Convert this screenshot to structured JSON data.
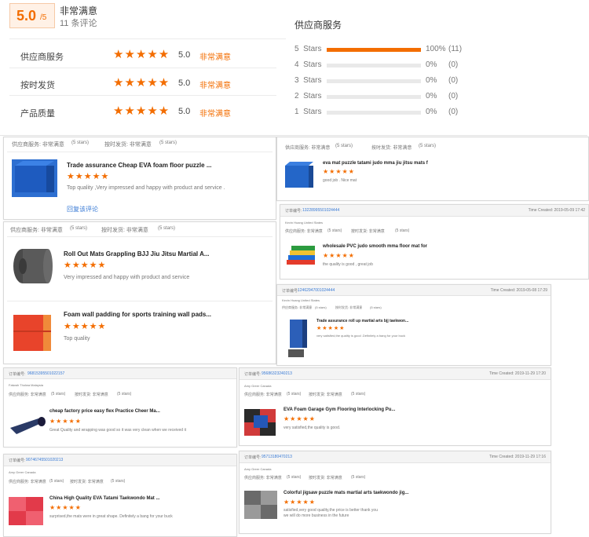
{
  "summary": {
    "score": "5.0",
    "score_max": "/5",
    "label": "非常满意",
    "review_count": "11 条评论",
    "ratings": [
      {
        "label": "供应商服务",
        "stars": "★★★★★",
        "value": "5.0",
        "verdict": "非常满意"
      },
      {
        "label": "按时发货",
        "stars": "★★★★★",
        "value": "5.0",
        "verdict": "非常满意"
      },
      {
        "label": "产品质量",
        "stars": "★★★★★",
        "value": "5.0",
        "verdict": "非常满意"
      }
    ]
  },
  "distribution": {
    "title": "供应商服务",
    "rows": [
      {
        "label": "5  Stars",
        "percent": "100%",
        "count": "(11)",
        "fill": 1.0
      },
      {
        "label": "4  Stars",
        "percent": "0%",
        "count": "(0)",
        "fill": 0
      },
      {
        "label": "3  Stars",
        "percent": "0%",
        "count": "(0)",
        "fill": 0
      },
      {
        "label": "2  Stars",
        "percent": "0%",
        "count": "(0)",
        "fill": 0
      },
      {
        "label": "1  Stars",
        "percent": "0%",
        "count": "(0)",
        "fill": 0
      }
    ]
  },
  "reviews": {
    "r1": {
      "supplier": "供应商服务:  非常满意",
      "supplier_stars": "(5 stars)",
      "ship": "按时发货:  非常满意",
      "ship_stars": "(5 stars)",
      "title": "Trade assurance Cheap EVA foam floor puzzle ...",
      "stars": "★★★★★",
      "comment": "Top quality ,Very impressed and happy with product and service .",
      "reply": "回复该评论"
    },
    "r2": {
      "supplier": "供应商服务:  非常满意",
      "supplier_stars": "(5 stars)",
      "ship": "按时发货:  非常满意",
      "ship_stars": "(5 stars)",
      "title": "eva mat puzzle tatami judo mma jiu jitsu mats f",
      "stars": "★★★★★",
      "comment": "good job . Nice mat"
    },
    "r3": {
      "order_label": "订单编号:",
      "order_no": "13228995501024444",
      "time": "Time Created:  2019-05-09 17:42",
      "buyer": "Kevin Hoang United States",
      "supplier": "供应商服务:  非常满意",
      "supplier_stars": "(5 stars)",
      "ship": "按时发货:  非常满意",
      "ship_stars": "(5 stars)",
      "title": "wholesale PVC judo smooth mma floor mat for",
      "stars": "★★★★★",
      "comment": "the quality is good ,  great job"
    },
    "r4": {
      "supplier": "供应商服务:  非常满意",
      "supplier_stars": "(5 stars)",
      "ship": "按时发货:  非常满意",
      "ship_stars": "(5 stars)",
      "item1_title": "Roll Out Mats Grappling BJJ Jiu Jitsu Martial A...",
      "item1_stars": "★★★★★",
      "item1_comment": "Very impressed and happy with product and service",
      "item2_title": "Foam wall padding for sports training wall pads...",
      "item2_stars": "★★★★★",
      "item2_comment": "Top quality"
    },
    "r5": {
      "order_label": "订单编号:",
      "order_no": "12462947001024444",
      "time": "Time Created:  2019-05-08 17:29",
      "buyer": "Kevin Hoang United States",
      "supplier": "供应商服务:  非常满意",
      "supplier_stars": "(5 stars)",
      "ship": "按时发货:  非常满意",
      "ship_stars": "(5 stars)",
      "title": "Trade assurance roll up martial arts bjj taekwon...",
      "stars": "★★★★★",
      "comment": "very satisfied,the quality is good .Definitely a bang for your buck"
    },
    "r6": {
      "order_label": "订单编号:",
      "order_no": "96815395501022157",
      "buyer": "Fatwah Tholwa Malaysia",
      "supplier": "供应商服务:  非常满意",
      "supplier_stars": "(5 stars)",
      "ship": "按时发货:  非常满意",
      "ship_stars": "(5 stars)",
      "title": "cheap factory price easy flex Practice Cheer Ma...",
      "stars": "★★★★★",
      "comment": "Great Quality and wrapping was good so it was very clean when we received it"
    },
    "r7": {
      "order_label": "订单编号:",
      "order_no": "95686323240213",
      "time": "Time Created:  2019-11-29 17:20",
      "buyer": "Amy Greer Canada",
      "supplier": "供应商服务:  非常满意",
      "supplier_stars": "(5 stars)",
      "ship": "按时发货:  非常满意",
      "ship_stars": "(5 stars)",
      "title": "EVA Foam Garage Gym Flooring Interlocking Pu...",
      "stars": "★★★★★",
      "comment": "very satisfied,the quality is good."
    },
    "r8": {
      "order_label": "订单编号:",
      "order_no": "90746745501020213",
      "buyer": "Amy Greer Canada",
      "supplier": "供应商服务:  非常满意",
      "supplier_stars": "(5 stars)",
      "ship": "按时发货:  非常满意",
      "ship_stars": "(5 stars)",
      "title": "China High Quality EVA Tatami Taekwondo Mat ...",
      "stars": "★★★★★",
      "comment": "surprised,the mats were in great shape. Definitely a bang for your buck"
    },
    "r9": {
      "order_label": "订单编号:",
      "order_no": "95713180470213",
      "time": "Time Created:  2019-11-29 17:16",
      "buyer": "Amy Greer Canada",
      "supplier": "供应商服务:  非常满意",
      "supplier_stars": "(5 stars)",
      "ship": "按时发货:  非常满意",
      "ship_stars": "(5 stars)",
      "title": "Colorful jigsaw puzzle mats martial arts taekwondo jig...",
      "stars": "★★★★★",
      "comment": "satisfied,very good quality,the price is better thank you",
      "comment2": "we will do more business in the future"
    }
  },
  "colors": {
    "accent": "#f36d00",
    "link": "#3a7bd5"
  }
}
